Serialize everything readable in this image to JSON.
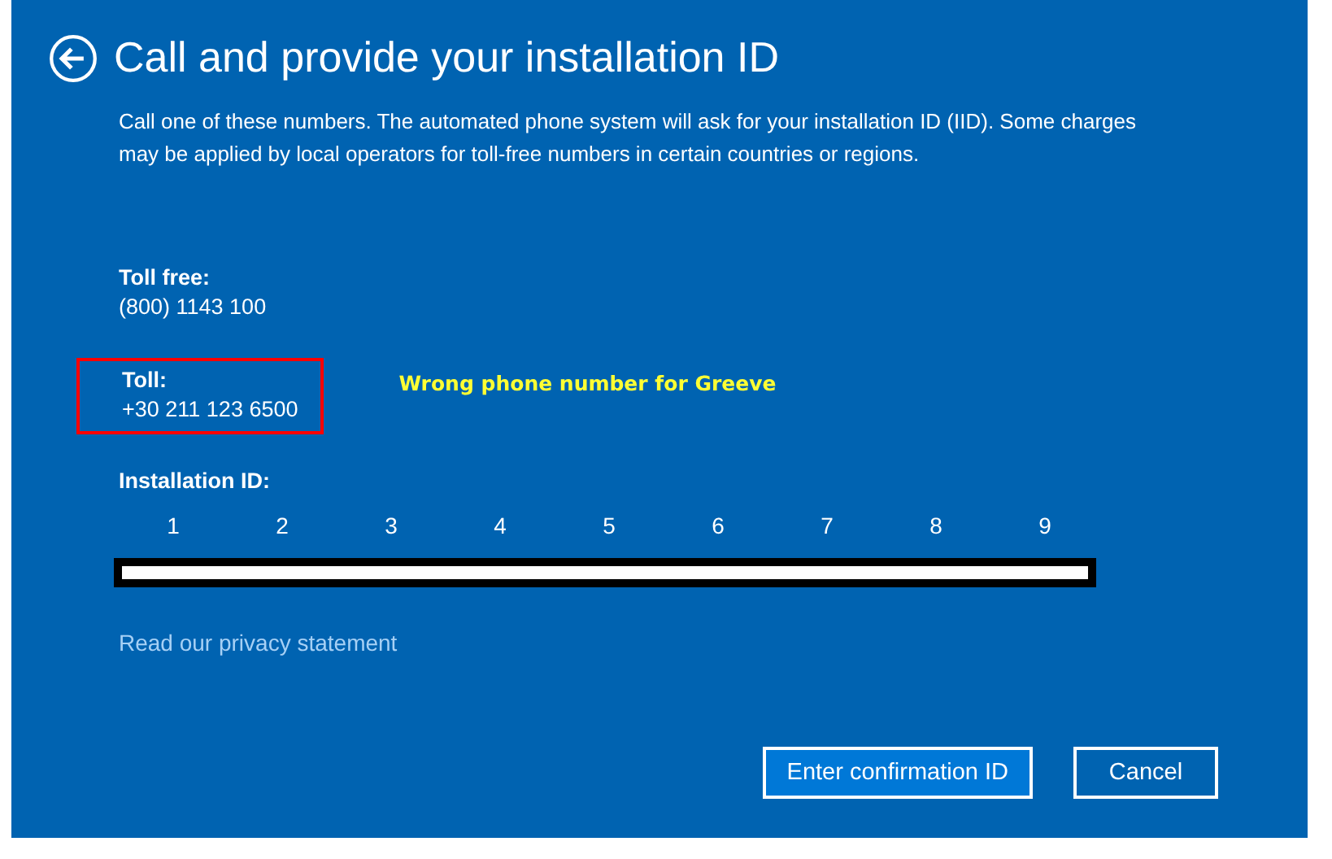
{
  "title": "Call and provide your installation ID",
  "description": "Call one of these numbers. The automated phone system will ask for your installation ID (IID). Some charges may be applied by local operators for toll-free numbers in certain countries or regions.",
  "phones": [
    {
      "label": "Toll free:",
      "number": "(800) 1143 100",
      "highlighted": false
    },
    {
      "label": "Toll:",
      "number": "+30 211 123 6500",
      "highlighted": true
    }
  ],
  "annotation": "Wrong phone number for Greeve",
  "installation_id": {
    "label": "Installation ID:",
    "groups": [
      "1",
      "2",
      "3",
      "4",
      "5",
      "6",
      "7",
      "8",
      "9"
    ]
  },
  "privacy_link": "Read our privacy statement",
  "buttons": [
    {
      "label": "Enter confirmation ID",
      "primary": true
    },
    {
      "label": "Cancel",
      "primary": false
    }
  ]
}
